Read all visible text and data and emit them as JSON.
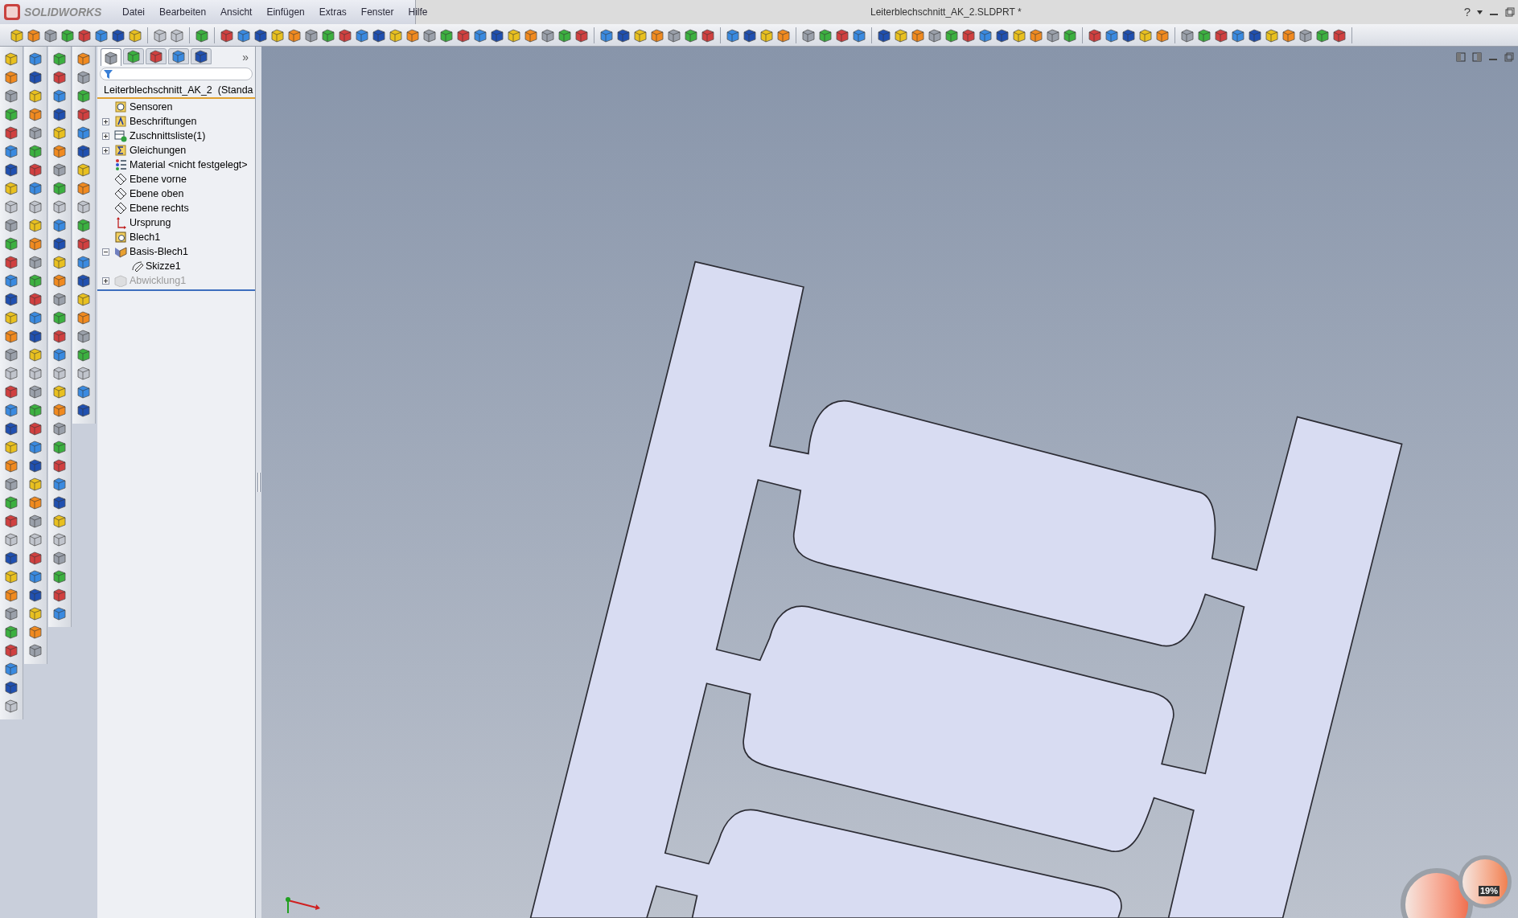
{
  "app": {
    "logo": "SOLIDWORKS"
  },
  "menu": [
    "Datei",
    "Bearbeiten",
    "Ansicht",
    "Einfügen",
    "Extras",
    "Fenster",
    "Hilfe"
  ],
  "window": {
    "title": "Leiterblechschnitt_AK_2.SLDPRT *",
    "help": "?"
  },
  "panel_tabs": [
    {
      "selected": true
    },
    {
      "selected": false
    },
    {
      "selected": false
    },
    {
      "selected": false
    },
    {
      "selected": false
    }
  ],
  "panel_more": "»",
  "feature_tree": {
    "root": "Leiterblechschnitt_AK_2  (Standa",
    "items": [
      {
        "label": "Sensoren",
        "kind": "sensor",
        "expandable": false,
        "suppressed": false
      },
      {
        "label": "Beschriftungen",
        "kind": "annotation",
        "expandable": true,
        "expanded": false,
        "suppressed": false
      },
      {
        "label": "Zuschnittsliste(1)",
        "kind": "cutlist",
        "expandable": true,
        "expanded": false,
        "suppressed": false
      },
      {
        "label": "Gleichungen",
        "kind": "equation",
        "expandable": true,
        "expanded": false,
        "suppressed": false
      },
      {
        "label": "Material <nicht festgelegt>",
        "kind": "material",
        "expandable": false,
        "suppressed": false
      },
      {
        "label": "Ebene vorne",
        "kind": "plane",
        "expandable": false,
        "suppressed": false
      },
      {
        "label": "Ebene oben",
        "kind": "plane",
        "expandable": false,
        "suppressed": false
      },
      {
        "label": "Ebene rechts",
        "kind": "plane",
        "expandable": false,
        "suppressed": false
      },
      {
        "label": "Ursprung",
        "kind": "origin",
        "expandable": false,
        "suppressed": false
      },
      {
        "label": "Blech1",
        "kind": "sheetmetal",
        "expandable": false,
        "suppressed": false
      },
      {
        "label": "Basis-Blech1",
        "kind": "flange",
        "expandable": true,
        "expanded": true,
        "suppressed": false,
        "children": [
          {
            "label": "Skizze1",
            "kind": "sketch",
            "expandable": false,
            "suppressed": false
          }
        ]
      },
      {
        "label": "Abwicklung1",
        "kind": "flatpattern",
        "expandable": true,
        "expanded": false,
        "suppressed": true
      }
    ]
  },
  "gadget": {
    "reading": "19%"
  }
}
